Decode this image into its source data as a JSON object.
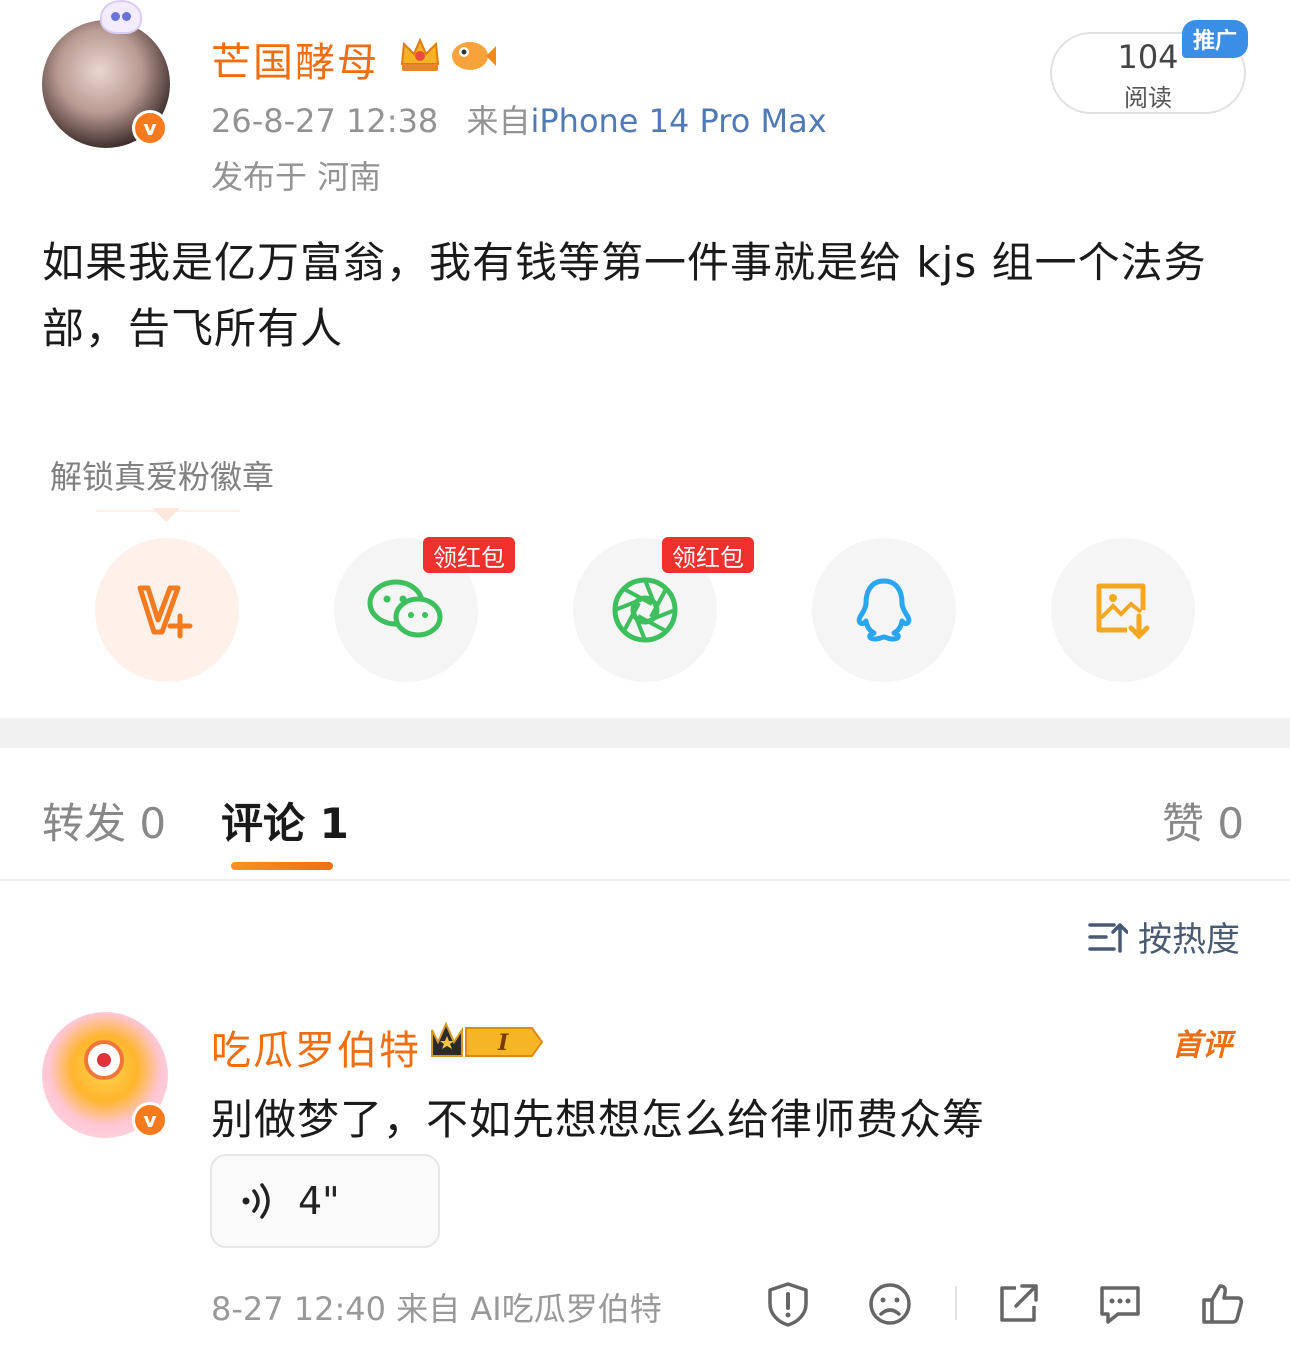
{
  "post": {
    "author_name": "芒国酵母",
    "timestamp": "26-8-27 12:38",
    "source_prefix": "来自",
    "source_device": "iPhone 14 Pro Max",
    "location": "发布于 河南",
    "read_count": "104",
    "read_label": "阅读",
    "promo_tag": "推广",
    "text": "如果我是亿万富翁，我有钱等第一件事就是给 kjs 组一个法务部，告飞所有人"
  },
  "share": {
    "unlock_label": "解锁真爱粉徽章",
    "buttons": [
      {
        "name": "v-plus",
        "icon": "v-plus-icon"
      },
      {
        "name": "wechat",
        "icon": "wechat-icon",
        "tag": "领红包"
      },
      {
        "name": "moments",
        "icon": "moments-icon",
        "tag": "领红包"
      },
      {
        "name": "qq",
        "icon": "qq-icon"
      },
      {
        "name": "save-image",
        "icon": "save-image-icon"
      }
    ]
  },
  "tabs": {
    "repost": "转发 0",
    "comments": "评论 1",
    "likes": "赞 0"
  },
  "sort": {
    "label": "按热度"
  },
  "comment": {
    "author_name": "吃瓜罗伯特",
    "first_tag": "首评",
    "text": "别做梦了，不如先想想怎么给律师费众筹",
    "voice_duration": "4\"",
    "meta": "8-27 12:40  来自 AI吃瓜罗伯特",
    "level": "I"
  },
  "colors": {
    "brand_orange": "#f06e10",
    "link_blue": "#4f7ab5",
    "wechat_green": "#3cbf5c",
    "qq_blue": "#2aa6f0",
    "red_tag": "#f0302c"
  }
}
